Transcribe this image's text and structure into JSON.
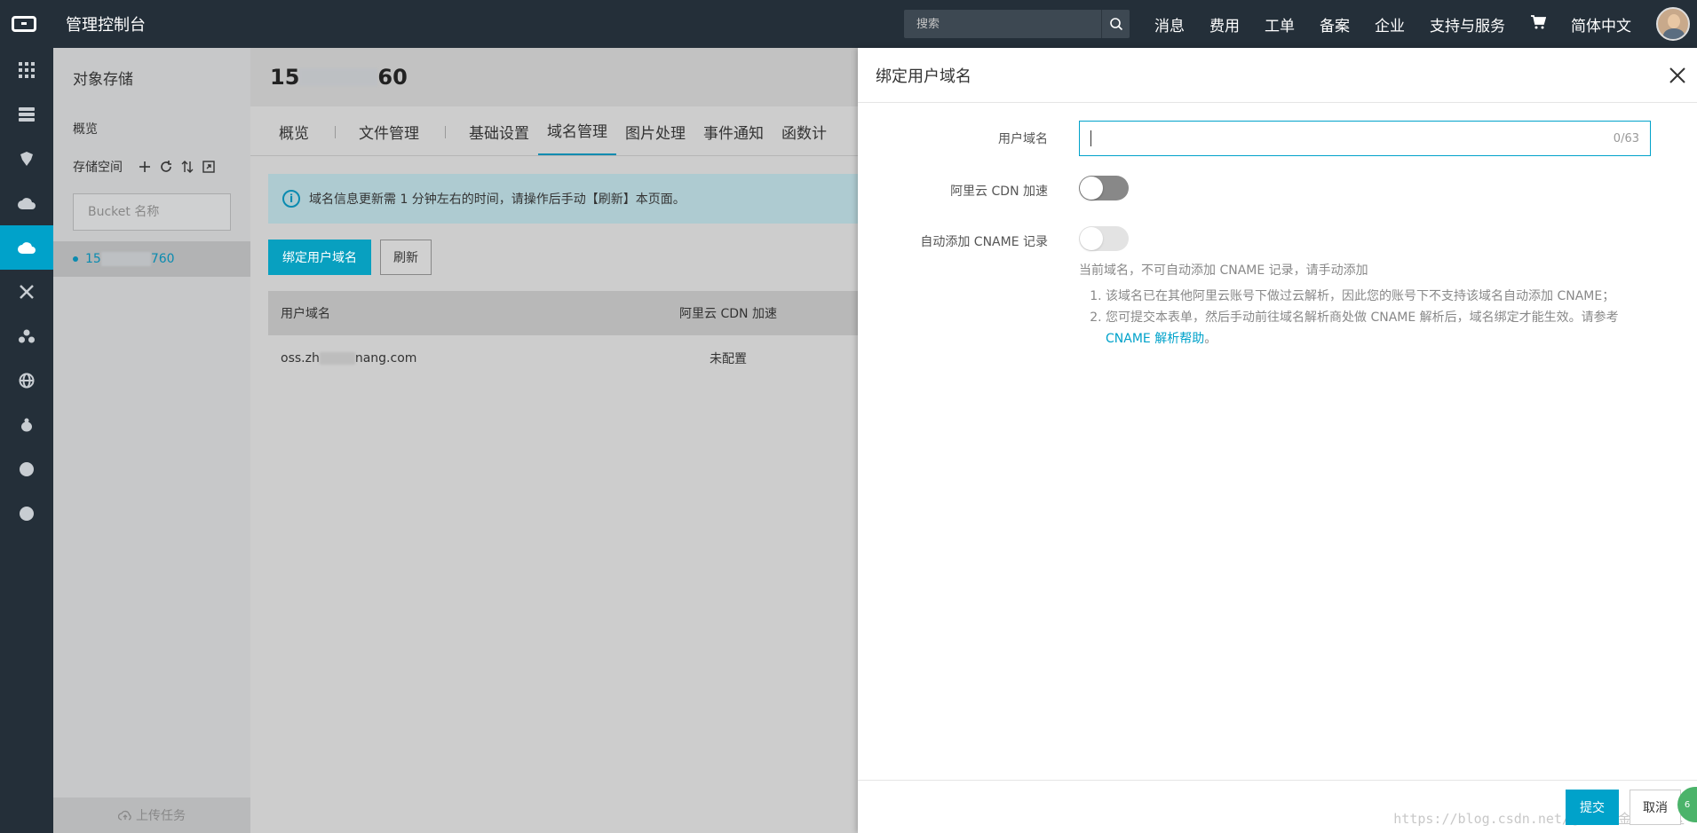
{
  "topbar": {
    "brand": "管理控制台",
    "search_placeholder": "搜索",
    "nav": [
      "消息",
      "费用",
      "工单",
      "备案",
      "企业",
      "支持与服务"
    ],
    "language": "简体中文"
  },
  "sidebar": {
    "title": "对象存储",
    "overview": "概览",
    "storage_label": "存储空间",
    "search_placeholder": "Bucket 名称",
    "bucket_prefix": "15",
    "bucket_suffix": "760",
    "footer": "上传任务"
  },
  "main": {
    "title_prefix": "15",
    "title_suffix": "60",
    "tabs": [
      "概览",
      "文件管理",
      "基础设置",
      "域名管理",
      "图片处理",
      "事件通知",
      "函数计"
    ],
    "active_tab": "域名管理",
    "notice": "域名信息更新需 1 分钟左右的时间，请操作后手动【刷新】本页面。",
    "bind_button": "绑定用户域名",
    "refresh_button": "刷新",
    "table": {
      "headers": [
        "用户域名",
        "阿里云 CDN 加速"
      ],
      "rows": [
        {
          "domain_prefix": "oss.zh",
          "domain_suffix": "nang.com",
          "cdn": "未配置"
        }
      ]
    }
  },
  "drawer": {
    "title": "绑定用户域名",
    "domain_label": "用户域名",
    "domain_value": "",
    "domain_counter": "0/63",
    "cdn_label": "阿里云 CDN 加速",
    "cdn_enabled": false,
    "cname_label": "自动添加 CNAME 记录",
    "cname_enabled": false,
    "cname_hint": "当前域名，不可自动添加 CNAME 记录，请手动添加",
    "notes": [
      "该域名已在其他阿里云账号下做过云解析，因此您的账号下不支持该域名自动添加 CNAME；",
      "您可提交本表单，然后手动前往域名解析商处做 CNAME 解析后，域名绑定才能生效。请参考"
    ],
    "notes_link": "CNAME 解析帮助",
    "notes_end": "。",
    "submit": "提交",
    "cancel": "取消",
    "watermark": "https://blog.csdn.net/@稀土掘金技术社区",
    "badge": "6"
  },
  "colors": {
    "accent": "#00a2ca",
    "topbar": "#242f39"
  }
}
